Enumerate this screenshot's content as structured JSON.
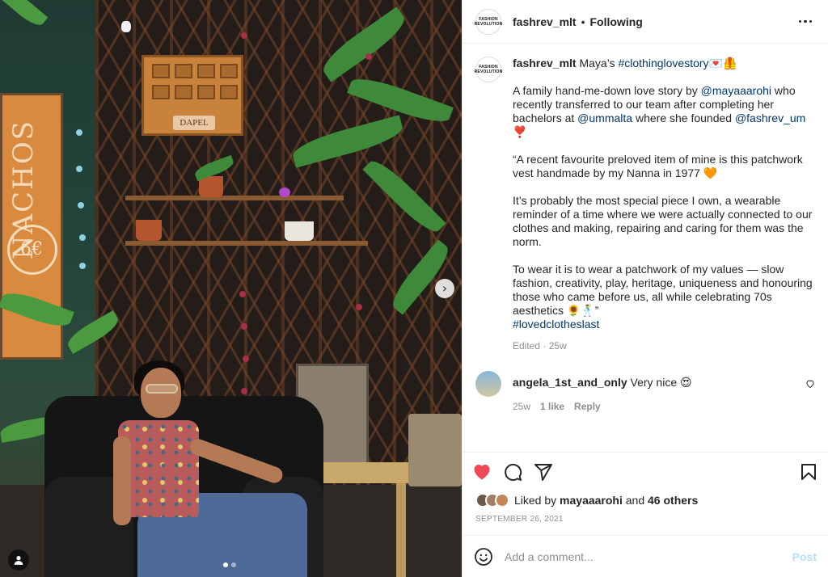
{
  "account": {
    "avatar_line1": "FASHION",
    "avatar_line2": "REVOLUTION",
    "username": "fashrev_mlt",
    "separator": "•",
    "follow_status": "Following"
  },
  "photo": {
    "sign_text": "NACHOS",
    "sign_circle_text": "6€",
    "cabinet_label": "DAPEL",
    "next_arrow": "›",
    "pagination_total": 2,
    "pagination_active": 1
  },
  "caption": {
    "username": "fashrev_mlt",
    "line1_text": "Maya’s",
    "line1_hashtag": "#clothinglovestory",
    "line1_emoji": "💌🦺",
    "p1_text_a": "A family hand-me-down love story by",
    "p1_mention_a": "@mayaaarohi",
    "p1_text_b": "who recently transferred to our team after completing her bachelors at",
    "p1_mention_b": "@ummalta",
    "p1_text_c": "where she founded",
    "p1_mention_c": "@fashrev_um",
    "p1_emoji": "❣️",
    "p2": "“A recent favourite preloved item of mine is this patchwork vest handmade by my Nanna in 1977 🧡",
    "p3": "It’s probably the most special piece I own, a wearable reminder of a time where we were actually connected to our clothes and making, repairing and caring for them was the norm.",
    "p4": "To wear it is to wear a patchwork of my values — slow fashion, creativity, play, heritage, uniqueness and honouring those who came before us, all while celebrating 70s aesthetics 🌻🕺”",
    "p4_hashtag": "#lovedclotheslast",
    "edited_meta": "Edited · 25w"
  },
  "comment": {
    "username": "angela_1st_and_only",
    "text": "Very nice 😍",
    "time": "25w",
    "likes": "1 like",
    "reply": "Reply"
  },
  "likes": {
    "prefix": "Liked by",
    "user": "mayaaarohi",
    "middle": "and",
    "others": "46 others"
  },
  "date": "SEPTEMBER 26, 2021",
  "composer": {
    "placeholder": "Add a comment...",
    "post_label": "Post"
  },
  "icons": {
    "like": "heart-filled-icon",
    "comment": "comment-bubble-icon",
    "share": "paper-plane-icon",
    "save": "bookmark-icon",
    "emoji": "smiley-icon",
    "tag": "user-tag-icon",
    "more": "more-options-icon"
  },
  "colors": {
    "like_red": "#ed4956",
    "link_blue": "#00376b",
    "muted_gray": "#8e8e8e",
    "post_disabled": "#b2dffc"
  }
}
